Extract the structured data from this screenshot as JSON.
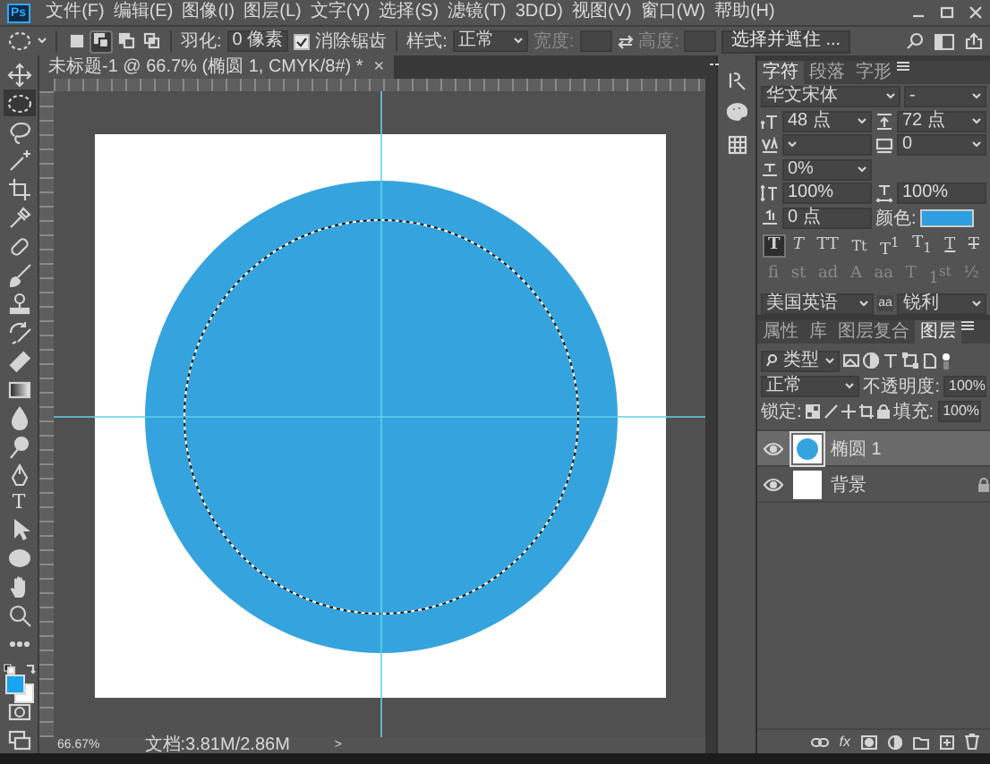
{
  "app": {
    "logo": "Ps"
  },
  "menu": [
    "文件(F)",
    "编辑(E)",
    "图像(I)",
    "图层(L)",
    "文字(Y)",
    "选择(S)",
    "滤镜(T)",
    "3D(D)",
    "视图(V)",
    "窗口(W)",
    "帮助(H)"
  ],
  "options_bar": {
    "modes": [
      {
        "kind": "new",
        "selected": false
      },
      {
        "kind": "add",
        "selected": true
      },
      {
        "kind": "subtract",
        "selected": false
      },
      {
        "kind": "intersect",
        "selected": false
      }
    ],
    "feather_label": "羽化:",
    "feather_value": "0 像素",
    "antialias": {
      "label": "消除锯齿",
      "checked": true
    },
    "style_label": "样式:",
    "style_value": "正常",
    "width_label": "宽度:",
    "height_label": "高度:",
    "size_disabled": true,
    "mask_button": "选择并遮住 ..."
  },
  "document_tab": {
    "title": "未标题-1 @ 66.7% (椭圆 1, CMYK/8#) *",
    "close": "×"
  },
  "tools": [
    {
      "kind": "move",
      "selected": false
    },
    {
      "kind": "ellipse_marquee",
      "selected": true
    },
    {
      "kind": "lasso",
      "selected": false
    },
    {
      "kind": "magic_wand",
      "selected": false
    },
    {
      "kind": "crop",
      "selected": false
    },
    {
      "kind": "eyedropper",
      "selected": false
    },
    {
      "kind": "healing",
      "selected": false
    },
    {
      "kind": "brush",
      "selected": false
    },
    {
      "kind": "stamp",
      "selected": false
    },
    {
      "kind": "history_brush",
      "selected": false
    },
    {
      "kind": "eraser",
      "selected": false
    },
    {
      "kind": "gradient",
      "selected": false
    },
    {
      "kind": "blur",
      "selected": false
    },
    {
      "kind": "dodge",
      "selected": false
    },
    {
      "kind": "pen",
      "selected": false
    },
    {
      "kind": "type",
      "label": "T",
      "selected": false
    },
    {
      "kind": "path_select",
      "selected": false
    },
    {
      "kind": "ellipse",
      "selected": false
    },
    {
      "kind": "hand",
      "selected": false
    },
    {
      "kind": "zoom",
      "selected": false
    },
    {
      "kind": "more",
      "selected": false
    }
  ],
  "colors": [
    {
      "kind": "foreground",
      "color": "#1aa3ee"
    },
    {
      "kind": "background",
      "color": "#ffffff"
    }
  ],
  "mode_tools": [
    {
      "kind": "quick_mask"
    },
    {
      "kind": "screen_mode"
    }
  ],
  "character_panel": {
    "tabs": [
      {
        "label": "字符",
        "selected": true
      },
      {
        "label": "段落",
        "selected": false
      },
      {
        "label": "字形",
        "selected": false
      }
    ],
    "font_family": "华文宋体",
    "font_style": "-",
    "size": "48 点",
    "leading": "72 点",
    "tracking": "0",
    "tsume": "0%",
    "vertical_scale": "100%",
    "horizontal_scale": "100%",
    "baseline_shift": "0 点",
    "color_label": "颜色:",
    "style_buttons": [
      {
        "label": "T",
        "kind": "bold",
        "selected": true
      },
      {
        "label": "T",
        "kind": "italic",
        "selected": false
      },
      {
        "label": "TT",
        "kind": "caps",
        "selected": false
      },
      {
        "label": "Tt",
        "kind": "small_caps",
        "selected": false
      },
      {
        "label": "T$^{1}$",
        "kind": "super",
        "selected": false
      },
      {
        "label": "T$_{1}$",
        "kind": "sub",
        "selected": false
      },
      {
        "label": "T",
        "kind": "underline",
        "selected": false
      },
      {
        "label": "T",
        "kind": "strike",
        "selected": false
      }
    ],
    "opentype_buttons": [
      {
        "label": "fi",
        "disabled": true
      },
      {
        "label": "st",
        "disabled": true
      },
      {
        "label": "ad",
        "disabled": true
      },
      {
        "label": "A",
        "disabled": true
      },
      {
        "label": "aa",
        "disabled": true
      },
      {
        "label": "T",
        "disabled": true
      },
      {
        "label": "1$^{st}$",
        "disabled": true
      },
      {
        "label": "½",
        "disabled": true
      }
    ],
    "language": "美国英语",
    "antialias_icon": "aa",
    "antialias": "锐利"
  },
  "layers_panel": {
    "tabs": [
      {
        "label": "属性",
        "selected": false
      },
      {
        "label": "库",
        "selected": false
      },
      {
        "label": "图层复合",
        "selected": false
      },
      {
        "label": "图层",
        "selected": true
      }
    ],
    "filter": "类型",
    "blend_mode": "正常",
    "opacity_label": "不透明度:",
    "opacity": "100%",
    "lock_label": "锁定:",
    "fill_label": "填充:",
    "fill": "100%",
    "effects_label": "fx",
    "layers": [
      {
        "name": "椭圆 1",
        "kind": "ellipse",
        "visible": true,
        "selected": true,
        "locked": false
      },
      {
        "name": "背景",
        "kind": "fill",
        "visible": true,
        "selected": false,
        "locked": true
      }
    ]
  },
  "status_bar": {
    "zoom": "66.67%",
    "doc_info": "文档:3.81M/2.86M",
    "arrow": ">"
  }
}
